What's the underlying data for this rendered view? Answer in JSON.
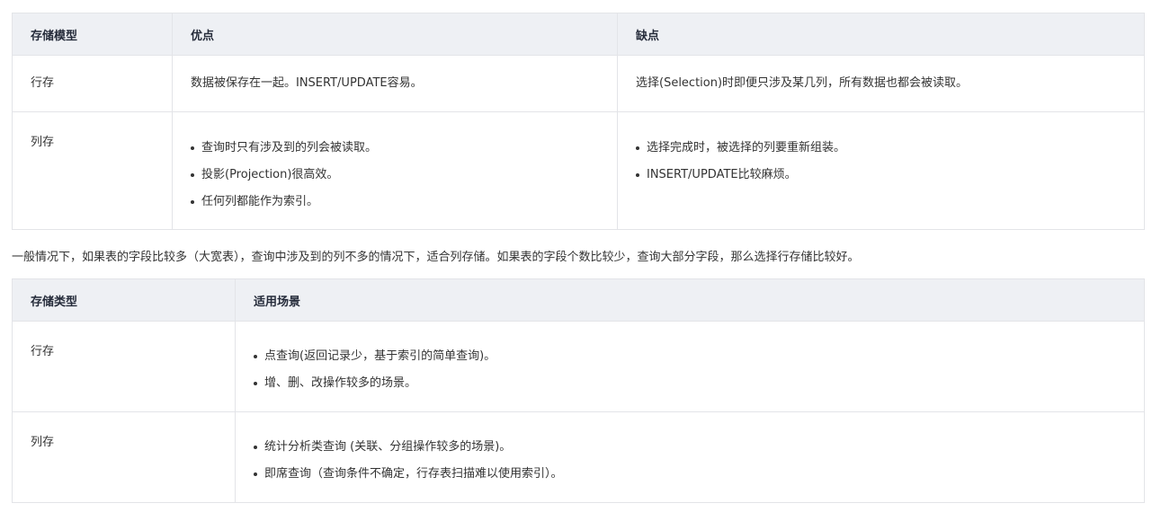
{
  "table1": {
    "headers": [
      "存储模型",
      "优点",
      "缺点"
    ],
    "rows": [
      {
        "model": "行存",
        "pros_text": "数据被保存在一起。INSERT/UPDATE容易。",
        "cons_text": "选择(Selection)时即便只涉及某几列，所有数据也都会被读取。"
      },
      {
        "model": "列存",
        "pros_list": [
          "查询时只有涉及到的列会被读取。",
          "投影(Projection)很高效。",
          "任何列都能作为索引。"
        ],
        "cons_list": [
          "选择完成时，被选择的列要重新组装。",
          "INSERT/UPDATE比较麻烦。"
        ]
      }
    ]
  },
  "paragraph": "一般情况下，如果表的字段比较多（大宽表），查询中涉及到的列不多的情况下，适合列存储。如果表的字段个数比较少，查询大部分字段，那么选择行存储比较好。",
  "table2": {
    "headers": [
      "存储类型",
      "适用场景"
    ],
    "rows": [
      {
        "type": "行存",
        "scenarios": [
          "点查询(返回记录少，基于索引的简单查询)。",
          "增、删、改操作较多的场景。"
        ]
      },
      {
        "type": "列存",
        "scenarios": [
          "统计分析类查询 (关联、分组操作较多的场景)。",
          "即席查询（查询条件不确定，行存表扫描难以使用索引）。"
        ]
      }
    ]
  }
}
